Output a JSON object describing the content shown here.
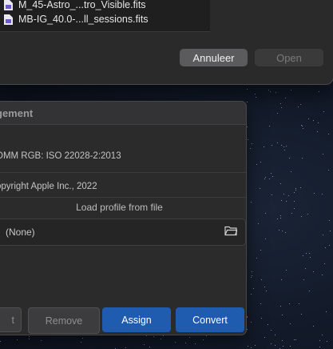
{
  "file_dialog": {
    "files": [
      {
        "name": "M_45-Astro_...tro_Visible.fits",
        "icon": "fits-file-icon"
      },
      {
        "name": "MB-IG_40.0-...ll_sessions.fits",
        "icon": "fits-file-icon"
      }
    ],
    "cancel_label": "Annuleer",
    "open_label": "Open"
  },
  "color_panel": {
    "title": "gement",
    "profile_description": "OMM RGB: ISO 22028-2:2013",
    "copyright": "opyright Apple Inc., 2022",
    "load_label": "Load profile from file",
    "profile_path": "(None)",
    "buttons": {
      "partial": "t",
      "remove": "Remove",
      "assign": "Assign",
      "convert": "Convert"
    }
  },
  "colors": {
    "accent": "#1f5cb0",
    "panel_bg": "#2b2b2c",
    "desktop": "#101725"
  }
}
